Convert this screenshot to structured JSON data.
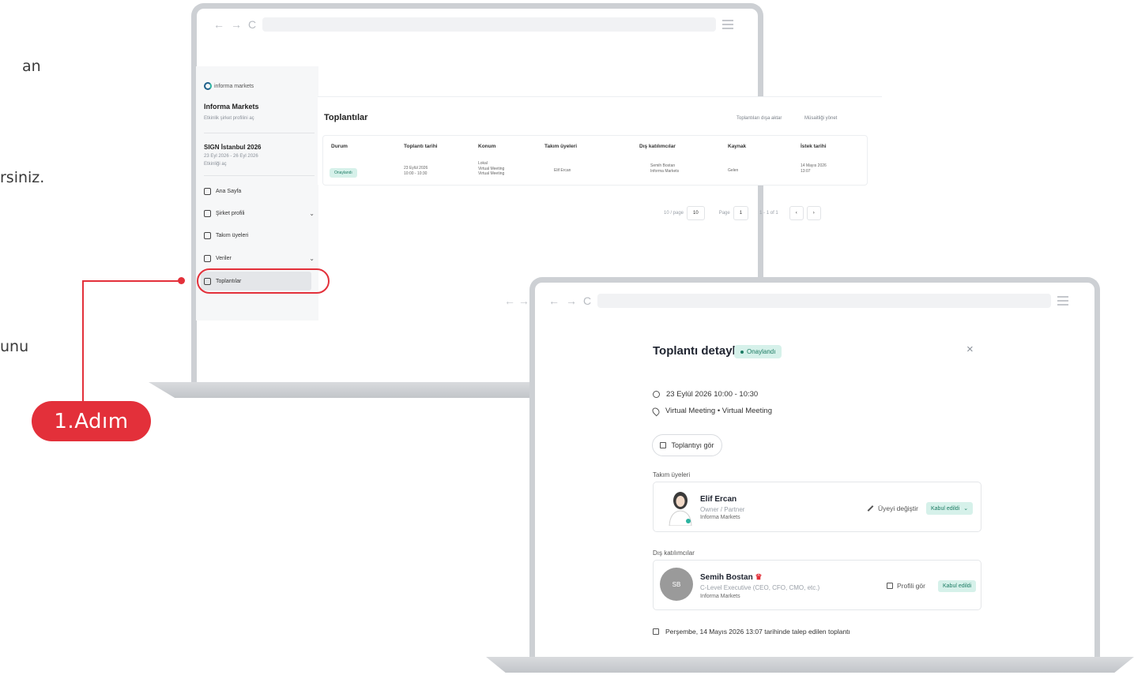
{
  "left_text": {
    "line1": "an",
    "line2": "rsiniz.",
    "line3": "unu"
  },
  "step": {
    "label": "1.Adım"
  },
  "browser": {
    "back": "←",
    "forward": "→",
    "reload": "C"
  },
  "sidebar": {
    "logo_text": "informa markets",
    "org_name": "Informa Markets",
    "org_link": "Etkinlik şirket profilini aç",
    "event_name": "SIGN İstanbul 2026",
    "event_dates": "23 Eyl 2026 - 26 Eyl 2026",
    "event_link": "Etkinliği aç",
    "items": [
      {
        "label": "Ana Sayfa",
        "icon": "home-icon"
      },
      {
        "label": "Şirket profili",
        "icon": "company-icon",
        "chevron": "⌄"
      },
      {
        "label": "Takım üyeleri",
        "icon": "team-icon"
      },
      {
        "label": "Veriler",
        "icon": "data-icon",
        "chevron": "⌄"
      },
      {
        "label": "Toplantılar",
        "icon": "meetings-icon"
      }
    ]
  },
  "meetings": {
    "title": "Toplantılar",
    "export_label": "Toplantıları dışa aktar",
    "manage_label": "Müsaitliği yönet",
    "columns": [
      "Durum",
      "Toplantı tarihi",
      "Konum",
      "Takım üyeleri",
      "Dış katılımcılar",
      "Kaynak",
      "İstek tarihi"
    ],
    "row": {
      "status": "Onaylandı",
      "date": "23 Eylül 2026",
      "time": "10:00 - 10:30",
      "location_1": "Lokal",
      "location_2": "Virtual Meeting",
      "location_3": "Virtual Meeting",
      "team_member": "Elif Ercan",
      "external_name": "Semih Bostan",
      "external_org": "Informa Markets",
      "source": "Gelen",
      "request_date": "14 Mayıs 2026",
      "request_time": "13:07"
    },
    "pager": {
      "per_page_label": "10 / page",
      "per_page_value": "10",
      "page_label": "Page",
      "page_value": "1",
      "range": "1 - 1 of 1",
      "prev": "‹",
      "next": "›"
    }
  },
  "modal": {
    "title": "Toplantı detayları",
    "status": "Onaylandı",
    "close": "×",
    "datetime": "23 Eylül 2026 10:00 - 10:30",
    "location": "Virtual Meeting • Virtual Meeting",
    "view_button": "Toplantıyı gör",
    "team_label": "Takım üyeleri",
    "team_member": {
      "name": "Elif Ercan",
      "role": "Owner / Partner",
      "org": "Informa Markets",
      "action": "Üyeyi değiştir",
      "status": "Kabul edildi",
      "status_chevron": "⌄"
    },
    "external_label": "Dış katılımcılar",
    "external": {
      "initials": "SB",
      "name": "Semih Bostan",
      "role": "C-Level Executive (CEO, CFO, CMO, etc.)",
      "org": "Informa Markets",
      "action": "Profili gör",
      "status": "Kabul edildi"
    },
    "footer": "Perşembe, 14 Mayıs 2026 13:07 tarihinde talep edilen toplantı"
  },
  "colors": {
    "accent": "#e3303a",
    "success_bg": "#d6f1ea",
    "success_text": "#1c7b63"
  }
}
